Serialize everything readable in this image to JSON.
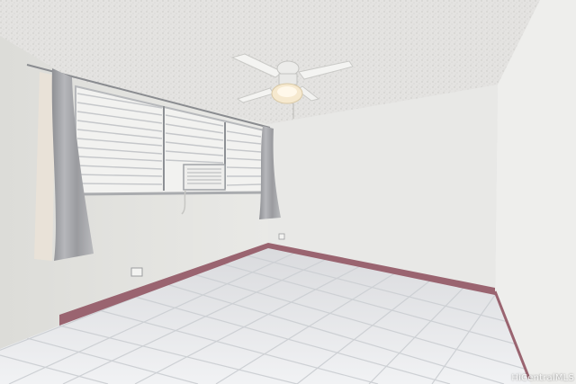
{
  "scene": {
    "kind": "empty-bedroom-photo",
    "objects": [
      "textured-ceiling",
      "ceiling-fan-light",
      "louvered-windows",
      "window-air-conditioner",
      "gray-curtains",
      "white-tile-floor",
      "pink-baseboards",
      "wall-outlet"
    ],
    "colors": {
      "ceiling": "#e4e3e1",
      "wall_right": "#eeeeec",
      "wall_back": "#e8e8e6",
      "wall_left": "#e2e2df",
      "floor": "#e6e7ea",
      "grout": "#cfd0d4",
      "baseboard": "#9a6470",
      "curtain": "#a8a9ad",
      "sheer": "#e9e2d8"
    }
  },
  "watermark": {
    "text": "HiCentralMLS"
  }
}
